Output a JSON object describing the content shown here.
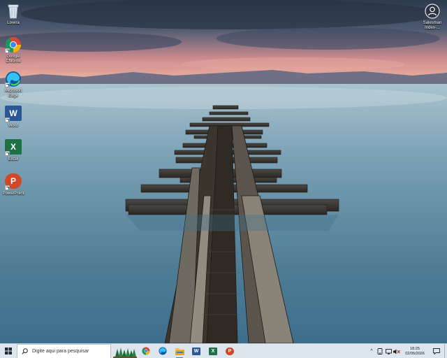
{
  "desktop": {
    "icons": [
      {
        "label": "Lixeira",
        "icon": "recycle-bin-icon"
      },
      {
        "label": "Google Chrome",
        "icon": "chrome-icon"
      },
      {
        "label": "Microsoft Edge",
        "icon": "edge-icon"
      },
      {
        "label": "Word",
        "icon": "word-icon",
        "letter": "W",
        "color": "#2b5797"
      },
      {
        "label": "Excel",
        "icon": "excel-icon",
        "letter": "X",
        "color": "#1e7145"
      },
      {
        "label": "PowerPoint",
        "icon": "powerpoint-icon",
        "letter": "P",
        "color": "#d24726"
      }
    ],
    "user_icon": {
      "label": "Salesman Index-...",
      "icon": "user-icon"
    }
  },
  "taskbar": {
    "start_icon": "windows-logo-icon",
    "search": {
      "placeholder": "Digite aqui para pesquisar",
      "icon": "search-icon"
    },
    "widget_icon": "trees-widget-icon",
    "apps": [
      {
        "name": "chrome",
        "icon": "chrome-icon"
      },
      {
        "name": "edge",
        "icon": "edge-icon"
      },
      {
        "name": "file-explorer",
        "icon": "folder-icon"
      },
      {
        "name": "word",
        "icon": "word-icon",
        "letter": "W",
        "color": "#2b5797"
      },
      {
        "name": "excel",
        "icon": "excel-icon",
        "letter": "X",
        "color": "#1e7145"
      },
      {
        "name": "powerpoint",
        "icon": "powerpoint-icon",
        "letter": "P",
        "color": "#d24726"
      }
    ],
    "tray": {
      "chevron": "^",
      "clock_time": "18:25",
      "clock_date": "02/05/2026"
    }
  }
}
